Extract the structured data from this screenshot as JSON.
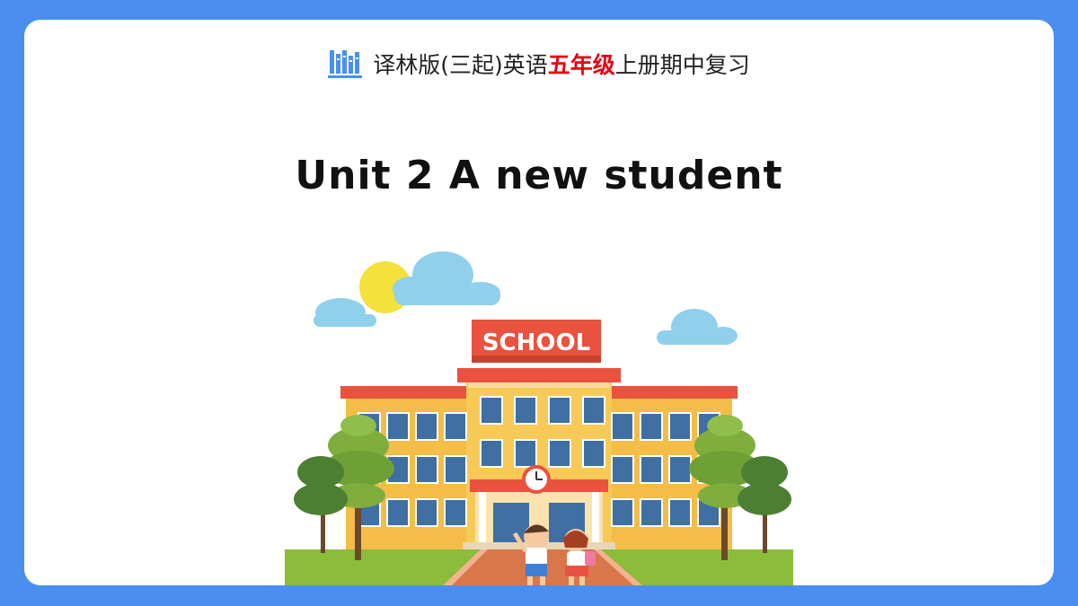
{
  "header": {
    "prefix": "译林版(三起)英语",
    "highlight": "五年级",
    "suffix": "上册期中复习",
    "icon": "books-icon",
    "icon_color": "#4a8ff0",
    "highlight_color": "#e60012"
  },
  "title": "Unit 2 A new student",
  "illustration": {
    "sign_text": "SCHOOL",
    "sign_color": "#e8523f",
    "sky_color": "#90d0ec",
    "sun_color": "#f3e23c",
    "wall_color": "#f4bd48",
    "grass_color": "#8bbd3a"
  },
  "colors": {
    "background": "#4a8ff0",
    "card": "#ffffff"
  }
}
